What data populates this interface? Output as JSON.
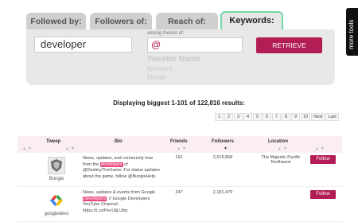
{
  "tabs": [
    {
      "label": "Followed by:"
    },
    {
      "label": "Followers of:"
    },
    {
      "label": "Reach of:"
    },
    {
      "label": "Keywords:"
    }
  ],
  "search": {
    "keyword_value": "developer",
    "among_label": "among friends of:",
    "at_value": "@",
    "hint_name": "Tweeter Name",
    "hint_followers": "followers",
    "hint_friends": "friends",
    "retrieve_label": "RETRIEVE"
  },
  "more_tools": "more tools",
  "results": {
    "title": "Displaying biggest 1-101 of 122,816 results:",
    "pages": [
      "1",
      "2",
      "3",
      "4",
      "5",
      "6",
      "7",
      "8",
      "9",
      "10",
      "Next",
      "Last"
    ]
  },
  "table": {
    "headers": {
      "tweep": "Tweep",
      "bio": "Bio",
      "friends": "Friends",
      "followers": "Followers",
      "location": "Location"
    },
    "rows": [
      {
        "handle": "Bungie",
        "bio_pre": "News, updates, and community love from the ",
        "bio_hl": "developers",
        "bio_post": " of @DestinyTheGame. For status updates about the game, follow @BungieHelp.",
        "friends": "191",
        "followers": "2,519,858",
        "location": "The Majestic Pacific Northwest",
        "follow_label": "Follow"
      },
      {
        "handle": "googledevs",
        "bio_pre": "News, updates & events from Google ",
        "bio_hl": "Developers",
        "bio_post": ". // Google Developers YouTube Channel: https://t.co/PecUtjLUltq",
        "friends": "247",
        "followers": "2,181,479",
        "location": "",
        "follow_label": "Follow"
      }
    ]
  },
  "colors": {
    "accent": "#b21d55",
    "highlight": "#e94882",
    "active_tab_border": "#6fd7a2",
    "panel_bg": "#e8e8e8",
    "header_bg": "#fbeef2"
  },
  "icons": {
    "row1_avatar": "bungie-logo-icon",
    "row2_avatar": "google-developers-logo-icon"
  }
}
